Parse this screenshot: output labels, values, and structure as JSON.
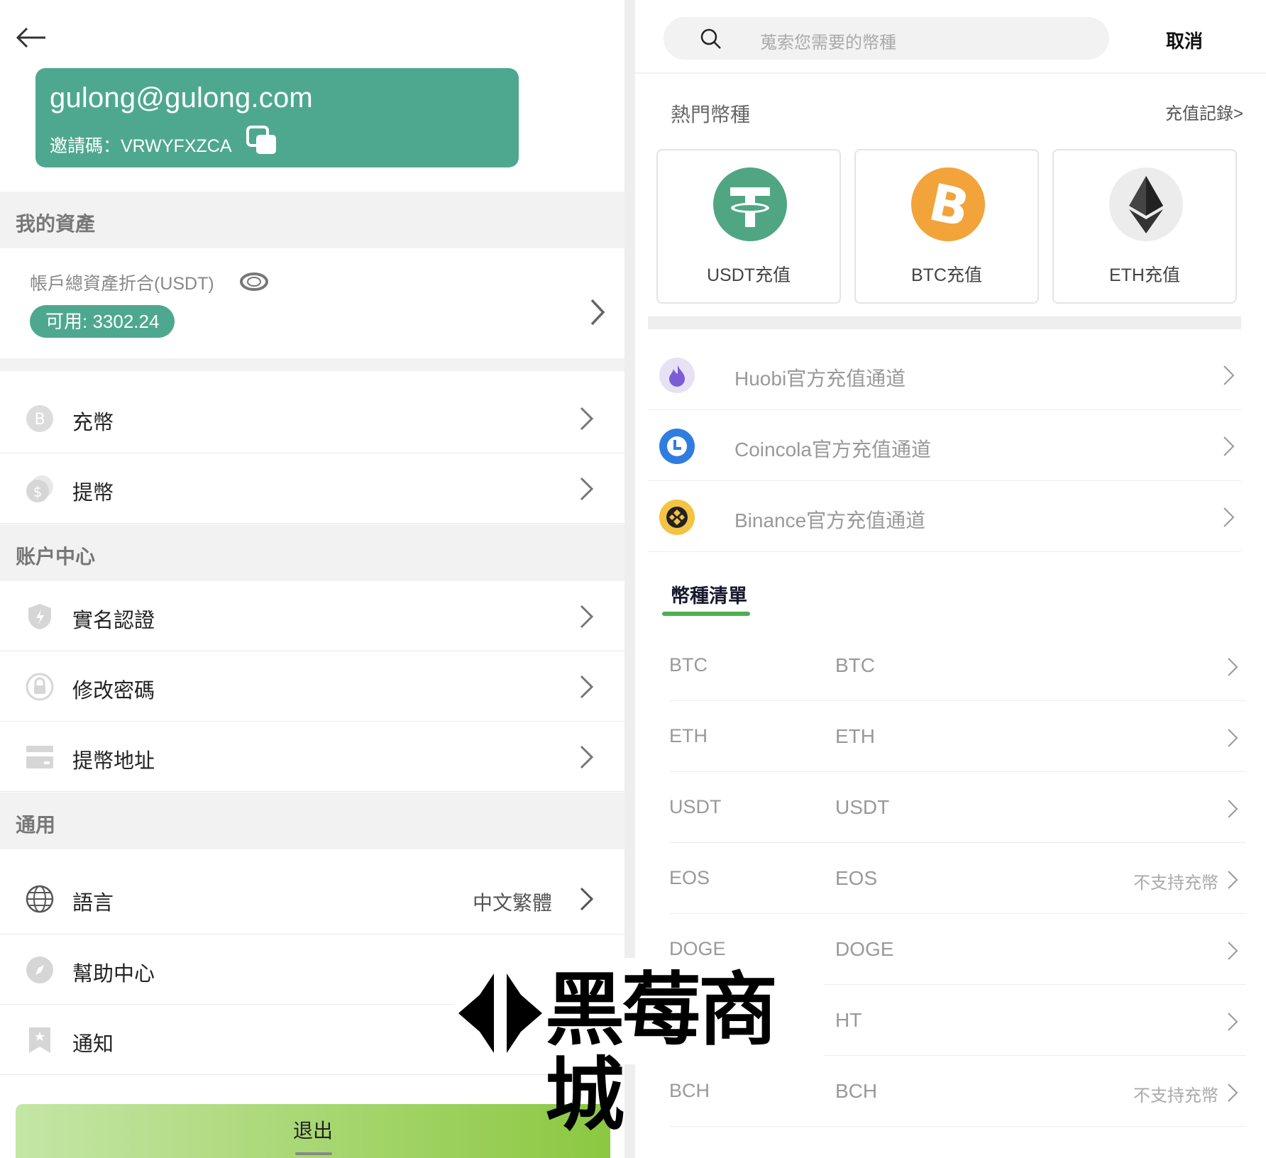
{
  "account": {
    "email": "gulong@gulong.com",
    "invite_label": "邀請碼：VRWYFXZCA"
  },
  "assets": {
    "section_title": "我的資產",
    "total_label": "帳戶總資產折合(USDT)",
    "available": "可用: 3302.24"
  },
  "menu_top": [
    {
      "label": "充幣"
    },
    {
      "label": "提幣"
    }
  ],
  "account_center": {
    "section_title": "账户中心",
    "items": [
      {
        "label": "實名認證"
      },
      {
        "label": "修改密碼"
      },
      {
        "label": "提幣地址"
      }
    ]
  },
  "general": {
    "section_title": "通用",
    "language_label": "語言",
    "language_value": "中文繁體",
    "help_label": "幫助中心",
    "notice_label": "通知"
  },
  "logout_label": "退出",
  "search": {
    "placeholder": "蒐索您需要的幣種",
    "cancel_label": "取消"
  },
  "hot": {
    "title": "熱門幣種",
    "records_link": "充值記錄>",
    "coins": [
      {
        "label": "USDT充值",
        "icon": "tether-icon",
        "color": "#50a683"
      },
      {
        "label": "BTC充值",
        "icon": "bitcoin-icon",
        "color": "#f2a33a"
      },
      {
        "label": "ETH充值",
        "icon": "ethereum-icon",
        "color": "#ececec"
      }
    ]
  },
  "channels": [
    {
      "label": "Huobi官方充值通道",
      "icon": "huobi-icon"
    },
    {
      "label": "Coincola官方充值通道",
      "icon": "coincola-icon"
    },
    {
      "label": "Binance官方充值通道",
      "icon": "binance-icon"
    }
  ],
  "coin_list": {
    "tab_label": "幣種清單",
    "rows": [
      {
        "symbol": "BTC",
        "name": "BTC",
        "note": ""
      },
      {
        "symbol": "ETH",
        "name": "ETH",
        "note": ""
      },
      {
        "symbol": "USDT",
        "name": "USDT",
        "note": ""
      },
      {
        "symbol": "EOS",
        "name": "EOS",
        "note": "不支持充幣"
      },
      {
        "symbol": "DOGE",
        "name": "DOGE",
        "note": ""
      },
      {
        "symbol": "",
        "name": "HT",
        "note": ""
      },
      {
        "symbol": "BCH",
        "name": "BCH",
        "note": "不支持充幣"
      }
    ]
  },
  "watermark": {
    "text": "黑莓商城"
  },
  "colors": {
    "brand_green": "#4ea890",
    "tab_underline": "#4caf50"
  }
}
